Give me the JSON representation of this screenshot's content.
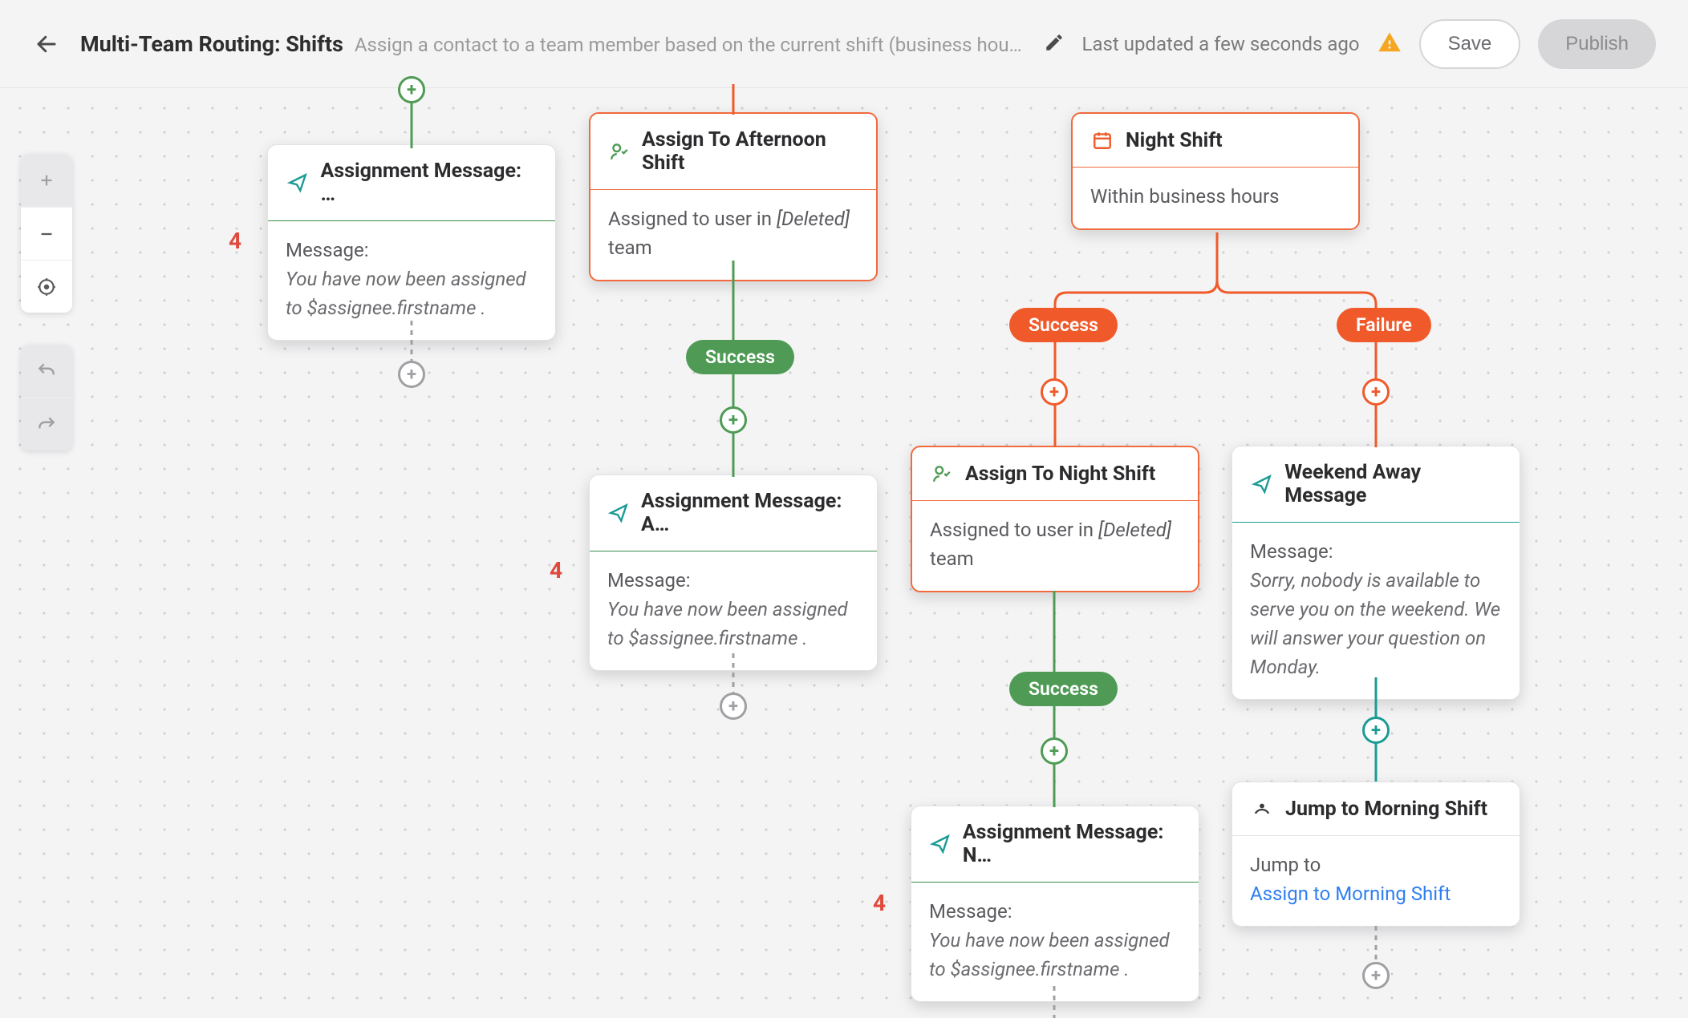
{
  "header": {
    "title": "Multi-Team Routing: Shifts",
    "subtitle": "Assign a contact to a team member based on the current shift (business hours…",
    "updated": "Last updated a few seconds ago",
    "save": "Save",
    "publish": "Publish"
  },
  "badges": {
    "count": "4"
  },
  "pills": {
    "success": "Success",
    "failure": "Failure"
  },
  "nodes": {
    "assign_msg_1": {
      "title": "Assignment Message: …",
      "body_label": "Message:",
      "body_text": "You have now been assigned to $assignee.firstname ."
    },
    "assign_afternoon": {
      "title": "Assign To Afternoon Shift",
      "body_pre": "Assigned to user in ",
      "body_deleted": "[Deleted]",
      "body_post": " team"
    },
    "night_shift": {
      "title": "Night Shift",
      "body": "Within business hours"
    },
    "assign_msg_2": {
      "title": "Assignment Message: A…",
      "body_label": "Message:",
      "body_text": "You have now been assigned to $assignee.firstname ."
    },
    "assign_night": {
      "title": "Assign To Night Shift",
      "body_pre": "Assigned to user in ",
      "body_deleted": "[Deleted]",
      "body_post": " team"
    },
    "weekend_away": {
      "title": "Weekend Away Message",
      "body_label": "Message:",
      "body_text": "Sorry, nobody is available to serve you on the weekend. We will answer your question on Monday."
    },
    "assign_msg_3": {
      "title": "Assignment Message: N…",
      "body_label": "Message:",
      "body_text": "You have now been assigned to $assignee.firstname ."
    },
    "jump_morning": {
      "title": "Jump to Morning Shift",
      "body_label": "Jump to",
      "body_link": "Assign to Morning Shift"
    }
  }
}
